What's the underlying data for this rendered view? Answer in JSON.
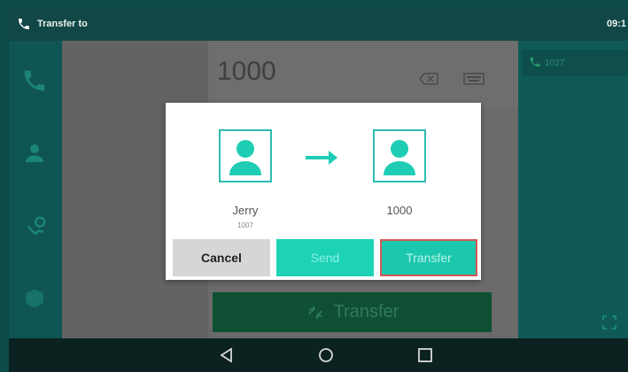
{
  "statusbar": {
    "title": "Transfer to",
    "time": "09:1"
  },
  "dialer": {
    "number": "1000",
    "transfer_label": "Transfer"
  },
  "right_panel": {
    "line_label": "1027"
  },
  "dialog": {
    "from": {
      "name": "Jerry",
      "number": "1007"
    },
    "to": {
      "name": "1000"
    },
    "buttons": {
      "cancel": "Cancel",
      "send": "Send",
      "transfer": "Transfer"
    }
  },
  "colors": {
    "accent": "#1ecdb3",
    "highlight_border": "#d95757"
  },
  "icons": {
    "status": "phone-icon",
    "sidebar": [
      "phone-icon",
      "contacts-icon",
      "call-history-icon",
      "voicemail-icon"
    ],
    "nav": [
      "back-icon",
      "home-icon",
      "recents-icon"
    ]
  }
}
